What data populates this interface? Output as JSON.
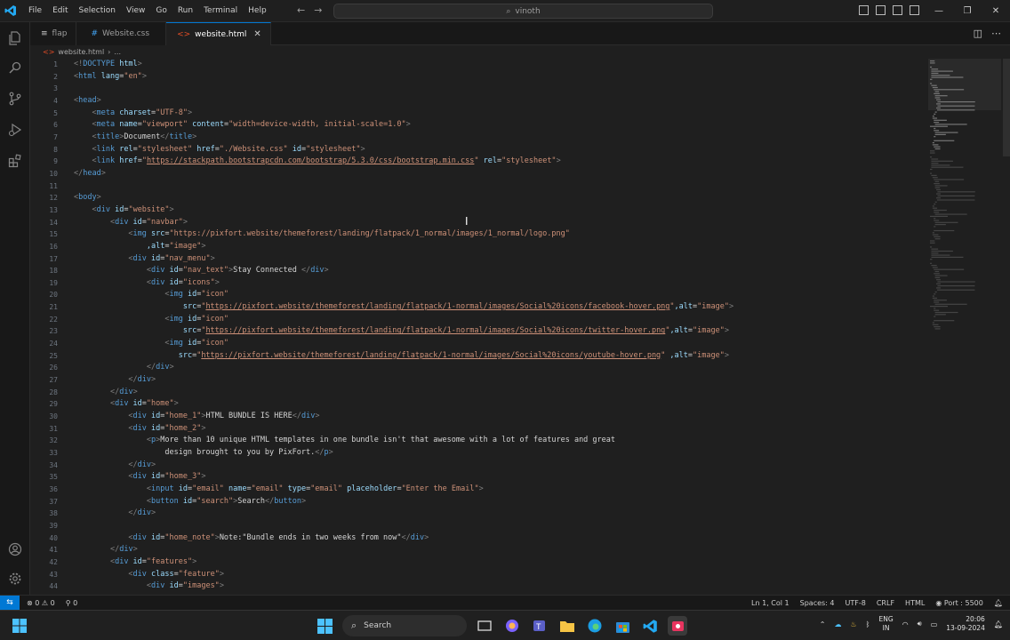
{
  "menu": [
    "File",
    "Edit",
    "Selection",
    "View",
    "Go",
    "Run",
    "Terminal",
    "Help"
  ],
  "search": {
    "text": "vinoth"
  },
  "tabs": [
    {
      "label": "flap",
      "icon": "≡",
      "icon_color": "#cccccc",
      "active": false
    },
    {
      "label": "Website.css",
      "icon": "#",
      "icon_color": "#42a5f5",
      "active": false
    },
    {
      "label": "website.html",
      "icon": "<>",
      "icon_color": "#e44d26",
      "active": true
    }
  ],
  "breadcrumb": {
    "file": "website.html",
    "rest": "..."
  },
  "line_numbers": [
    1,
    2,
    3,
    4,
    5,
    6,
    7,
    8,
    9,
    10,
    11,
    12,
    13,
    14,
    15,
    16,
    17,
    18,
    19,
    20,
    21,
    22,
    23,
    24,
    25,
    26,
    27,
    28,
    29,
    30,
    31,
    32,
    33,
    34,
    35,
    36,
    37,
    38,
    39,
    40,
    41,
    42,
    43,
    44
  ],
  "code_lines": [
    [
      [
        "b",
        "<!"
      ],
      [
        "g",
        "DOCTYPE"
      ],
      [
        "a",
        " html"
      ],
      [
        "b",
        ">"
      ]
    ],
    [
      [
        "b",
        "<"
      ],
      [
        "g",
        "html"
      ],
      [
        "a",
        " lang"
      ],
      [
        "t",
        "="
      ],
      [
        "s",
        "\"en\""
      ],
      [
        "b",
        ">"
      ]
    ],
    [],
    [
      [
        "b",
        "<"
      ],
      [
        "g",
        "head"
      ],
      [
        "b",
        ">"
      ]
    ],
    [
      [
        "t",
        "    "
      ],
      [
        "b",
        "<"
      ],
      [
        "g",
        "meta"
      ],
      [
        "a",
        " charset"
      ],
      [
        "t",
        "="
      ],
      [
        "s",
        "\"UTF-8\""
      ],
      [
        "b",
        ">"
      ]
    ],
    [
      [
        "t",
        "    "
      ],
      [
        "b",
        "<"
      ],
      [
        "g",
        "meta"
      ],
      [
        "a",
        " name"
      ],
      [
        "t",
        "="
      ],
      [
        "s",
        "\"viewport\""
      ],
      [
        "a",
        " content"
      ],
      [
        "t",
        "="
      ],
      [
        "s",
        "\"width=device-width, initial-scale=1.0\""
      ],
      [
        "b",
        ">"
      ]
    ],
    [
      [
        "t",
        "    "
      ],
      [
        "b",
        "<"
      ],
      [
        "g",
        "title"
      ],
      [
        "b",
        ">"
      ],
      [
        "t",
        "Document"
      ],
      [
        "b",
        "</"
      ],
      [
        "g",
        "title"
      ],
      [
        "b",
        ">"
      ]
    ],
    [
      [
        "t",
        "    "
      ],
      [
        "b",
        "<"
      ],
      [
        "g",
        "link"
      ],
      [
        "a",
        " rel"
      ],
      [
        "t",
        "="
      ],
      [
        "s",
        "\"stylesheet\""
      ],
      [
        "a",
        " href"
      ],
      [
        "t",
        "="
      ],
      [
        "s",
        "\"./Website.css\""
      ],
      [
        "a",
        " id"
      ],
      [
        "t",
        "="
      ],
      [
        "s",
        "\"stylesheet\""
      ],
      [
        "b",
        ">"
      ]
    ],
    [
      [
        "t",
        "    "
      ],
      [
        "b",
        "<"
      ],
      [
        "g",
        "link"
      ],
      [
        "a",
        " href"
      ],
      [
        "t",
        "="
      ],
      [
        "s",
        "\""
      ],
      [
        "u",
        "https://stackpath.bootstrapcdn.com/bootstrap/5.3.0/css/bootstrap.min.css"
      ],
      [
        "s",
        "\""
      ],
      [
        "a",
        " rel"
      ],
      [
        "t",
        "="
      ],
      [
        "s",
        "\"stylesheet\""
      ],
      [
        "b",
        ">"
      ]
    ],
    [
      [
        "b",
        "</"
      ],
      [
        "g",
        "head"
      ],
      [
        "b",
        ">"
      ]
    ],
    [],
    [
      [
        "b",
        "<"
      ],
      [
        "g",
        "body"
      ],
      [
        "b",
        ">"
      ]
    ],
    [
      [
        "t",
        "    "
      ],
      [
        "b",
        "<"
      ],
      [
        "g",
        "div"
      ],
      [
        "a",
        " id"
      ],
      [
        "t",
        "="
      ],
      [
        "s",
        "\"website\""
      ],
      [
        "b",
        ">"
      ]
    ],
    [
      [
        "t",
        "        "
      ],
      [
        "b",
        "<"
      ],
      [
        "g",
        "div"
      ],
      [
        "a",
        " id"
      ],
      [
        "t",
        "="
      ],
      [
        "s",
        "\"navbar\""
      ],
      [
        "b",
        ">"
      ]
    ],
    [
      [
        "t",
        "            "
      ],
      [
        "b",
        "<"
      ],
      [
        "g",
        "img"
      ],
      [
        "a",
        " src"
      ],
      [
        "t",
        "="
      ],
      [
        "s",
        "\"https://pixfort.website/themeforest/landing/flatpack/1_normal/images/1_normal/logo.png\""
      ]
    ],
    [
      [
        "t",
        "                "
      ],
      [
        "a",
        ",alt"
      ],
      [
        "t",
        "="
      ],
      [
        "s",
        "\"image\""
      ],
      [
        "b",
        ">"
      ]
    ],
    [
      [
        "t",
        "            "
      ],
      [
        "b",
        "<"
      ],
      [
        "g",
        "div"
      ],
      [
        "a",
        " id"
      ],
      [
        "t",
        "="
      ],
      [
        "s",
        "\"nav_menu\""
      ],
      [
        "b",
        ">"
      ]
    ],
    [
      [
        "t",
        "                "
      ],
      [
        "b",
        "<"
      ],
      [
        "g",
        "div"
      ],
      [
        "a",
        " id"
      ],
      [
        "t",
        "="
      ],
      [
        "s",
        "\"nav_text\""
      ],
      [
        "b",
        ">"
      ],
      [
        "t",
        "Stay Connected "
      ],
      [
        "b",
        "</"
      ],
      [
        "g",
        "div"
      ],
      [
        "b",
        ">"
      ]
    ],
    [
      [
        "t",
        "                "
      ],
      [
        "b",
        "<"
      ],
      [
        "g",
        "div"
      ],
      [
        "a",
        " id"
      ],
      [
        "t",
        "="
      ],
      [
        "s",
        "\"icons\""
      ],
      [
        "b",
        ">"
      ]
    ],
    [
      [
        "t",
        "                    "
      ],
      [
        "b",
        "<"
      ],
      [
        "g",
        "img"
      ],
      [
        "a",
        " id"
      ],
      [
        "t",
        "="
      ],
      [
        "s",
        "\"icon\""
      ]
    ],
    [
      [
        "t",
        "                        "
      ],
      [
        "a",
        "src"
      ],
      [
        "t",
        "="
      ],
      [
        "s",
        "\""
      ],
      [
        "u",
        "https://pixfort.website/themeforest/landing/flatpack/1-normal/images/Social%20icons/facebook-hover.png"
      ],
      [
        "s",
        "\""
      ],
      [
        "a",
        ",alt"
      ],
      [
        "t",
        "="
      ],
      [
        "s",
        "\"image\""
      ],
      [
        "b",
        ">"
      ]
    ],
    [
      [
        "t",
        "                    "
      ],
      [
        "b",
        "<"
      ],
      [
        "g",
        "img"
      ],
      [
        "a",
        " id"
      ],
      [
        "t",
        "="
      ],
      [
        "s",
        "\"icon\""
      ]
    ],
    [
      [
        "t",
        "                        "
      ],
      [
        "a",
        "src"
      ],
      [
        "t",
        "="
      ],
      [
        "s",
        "\""
      ],
      [
        "u",
        "https://pixfort.website/themeforest/landing/flatpack/1-normal/images/Social%20icons/twitter-hover.png"
      ],
      [
        "s",
        "\""
      ],
      [
        "a",
        ",alt"
      ],
      [
        "t",
        "="
      ],
      [
        "s",
        "\"image\""
      ],
      [
        "b",
        ">"
      ]
    ],
    [
      [
        "t",
        "                    "
      ],
      [
        "b",
        "<"
      ],
      [
        "g",
        "img"
      ],
      [
        "a",
        " id"
      ],
      [
        "t",
        "="
      ],
      [
        "s",
        "\"icon\""
      ]
    ],
    [
      [
        "t",
        "                       "
      ],
      [
        "a",
        "src"
      ],
      [
        "t",
        "="
      ],
      [
        "s",
        "\""
      ],
      [
        "u",
        "https://pixfort.website/themeforest/landing/flatpack/1-normal/images/Social%20icons/youtube-hover.png"
      ],
      [
        "s",
        "\""
      ],
      [
        "a",
        " ,alt"
      ],
      [
        "t",
        "="
      ],
      [
        "s",
        "\"image\""
      ],
      [
        "b",
        ">"
      ]
    ],
    [
      [
        "t",
        "                "
      ],
      [
        "b",
        "</"
      ],
      [
        "g",
        "div"
      ],
      [
        "b",
        ">"
      ]
    ],
    [
      [
        "t",
        "            "
      ],
      [
        "b",
        "</"
      ],
      [
        "g",
        "div"
      ],
      [
        "b",
        ">"
      ]
    ],
    [
      [
        "t",
        "        "
      ],
      [
        "b",
        "</"
      ],
      [
        "g",
        "div"
      ],
      [
        "b",
        ">"
      ]
    ],
    [
      [
        "t",
        "        "
      ],
      [
        "b",
        "<"
      ],
      [
        "g",
        "div"
      ],
      [
        "a",
        " id"
      ],
      [
        "t",
        "="
      ],
      [
        "s",
        "\"home\""
      ],
      [
        "b",
        ">"
      ]
    ],
    [
      [
        "t",
        "            "
      ],
      [
        "b",
        "<"
      ],
      [
        "g",
        "div"
      ],
      [
        "a",
        " id"
      ],
      [
        "t",
        "="
      ],
      [
        "s",
        "\"home_1\""
      ],
      [
        "b",
        ">"
      ],
      [
        "t",
        "HTML BUNDLE IS HERE"
      ],
      [
        "b",
        "</"
      ],
      [
        "g",
        "div"
      ],
      [
        "b",
        ">"
      ]
    ],
    [
      [
        "t",
        "            "
      ],
      [
        "b",
        "<"
      ],
      [
        "g",
        "div"
      ],
      [
        "a",
        " id"
      ],
      [
        "t",
        "="
      ],
      [
        "s",
        "\"home_2\""
      ],
      [
        "b",
        ">"
      ]
    ],
    [
      [
        "t",
        "                "
      ],
      [
        "b",
        "<"
      ],
      [
        "g",
        "p"
      ],
      [
        "b",
        ">"
      ],
      [
        "t",
        "More than 10 unique HTML templates in one bundle isn't that awesome with a lot of features and great"
      ]
    ],
    [
      [
        "t",
        "                    design brought to you by PixFort."
      ],
      [
        "b",
        "</"
      ],
      [
        "g",
        "p"
      ],
      [
        "b",
        ">"
      ]
    ],
    [
      [
        "t",
        "            "
      ],
      [
        "b",
        "</"
      ],
      [
        "g",
        "div"
      ],
      [
        "b",
        ">"
      ]
    ],
    [
      [
        "t",
        "            "
      ],
      [
        "b",
        "<"
      ],
      [
        "g",
        "div"
      ],
      [
        "a",
        " id"
      ],
      [
        "t",
        "="
      ],
      [
        "s",
        "\"home_3\""
      ],
      [
        "b",
        ">"
      ]
    ],
    [
      [
        "t",
        "                "
      ],
      [
        "b",
        "<"
      ],
      [
        "g",
        "input"
      ],
      [
        "a",
        " id"
      ],
      [
        "t",
        "="
      ],
      [
        "s",
        "\"email\""
      ],
      [
        "a",
        " name"
      ],
      [
        "t",
        "="
      ],
      [
        "s",
        "\"email\""
      ],
      [
        "a",
        " type"
      ],
      [
        "t",
        "="
      ],
      [
        "s",
        "\"email\""
      ],
      [
        "a",
        " placeholder"
      ],
      [
        "t",
        "="
      ],
      [
        "s",
        "\"Enter the Email\""
      ],
      [
        "b",
        ">"
      ]
    ],
    [
      [
        "t",
        "                "
      ],
      [
        "b",
        "<"
      ],
      [
        "g",
        "button"
      ],
      [
        "a",
        " id"
      ],
      [
        "t",
        "="
      ],
      [
        "s",
        "\"search\""
      ],
      [
        "b",
        ">"
      ],
      [
        "t",
        "Search"
      ],
      [
        "b",
        "</"
      ],
      [
        "g",
        "button"
      ],
      [
        "b",
        ">"
      ]
    ],
    [
      [
        "t",
        "            "
      ],
      [
        "b",
        "</"
      ],
      [
        "g",
        "div"
      ],
      [
        "b",
        ">"
      ]
    ],
    [],
    [
      [
        "t",
        "            "
      ],
      [
        "b",
        "<"
      ],
      [
        "g",
        "div"
      ],
      [
        "a",
        " id"
      ],
      [
        "t",
        "="
      ],
      [
        "s",
        "\"home_note\""
      ],
      [
        "b",
        ">"
      ],
      [
        "t",
        "Note:\"Bundle ends in two weeks from now\""
      ],
      [
        "b",
        "</"
      ],
      [
        "g",
        "div"
      ],
      [
        "b",
        ">"
      ]
    ],
    [
      [
        "t",
        "        "
      ],
      [
        "b",
        "</"
      ],
      [
        "g",
        "div"
      ],
      [
        "b",
        ">"
      ]
    ],
    [
      [
        "t",
        "        "
      ],
      [
        "b",
        "<"
      ],
      [
        "g",
        "div"
      ],
      [
        "a",
        " id"
      ],
      [
        "t",
        "="
      ],
      [
        "s",
        "\"features\""
      ],
      [
        "b",
        ">"
      ]
    ],
    [
      [
        "t",
        "            "
      ],
      [
        "b",
        "<"
      ],
      [
        "g",
        "div"
      ],
      [
        "a",
        " class"
      ],
      [
        "t",
        "="
      ],
      [
        "s",
        "\"feature\""
      ],
      [
        "b",
        ">"
      ]
    ],
    [
      [
        "t",
        "                "
      ],
      [
        "b",
        "<"
      ],
      [
        "g",
        "div"
      ],
      [
        "a",
        " id"
      ],
      [
        "t",
        "="
      ],
      [
        "s",
        "\"images\""
      ],
      [
        "b",
        ">"
      ]
    ]
  ],
  "status": {
    "errors": "0",
    "warnings": "0",
    "ports": "0",
    "position": "Ln 1, Col 1",
    "spaces": "Spaces: 4",
    "encoding": "UTF-8",
    "eol": "CRLF",
    "language": "HTML",
    "port": "Port : 5500"
  },
  "taskbar": {
    "search_placeholder": "Search",
    "lang_top": "ENG",
    "lang_bottom": "IN",
    "time": "20:06",
    "date": "13-09-2024"
  },
  "colors": {
    "accent": "#0078d4",
    "tag": "#569cd6",
    "attr": "#9cdcfe",
    "string": "#ce9178"
  }
}
